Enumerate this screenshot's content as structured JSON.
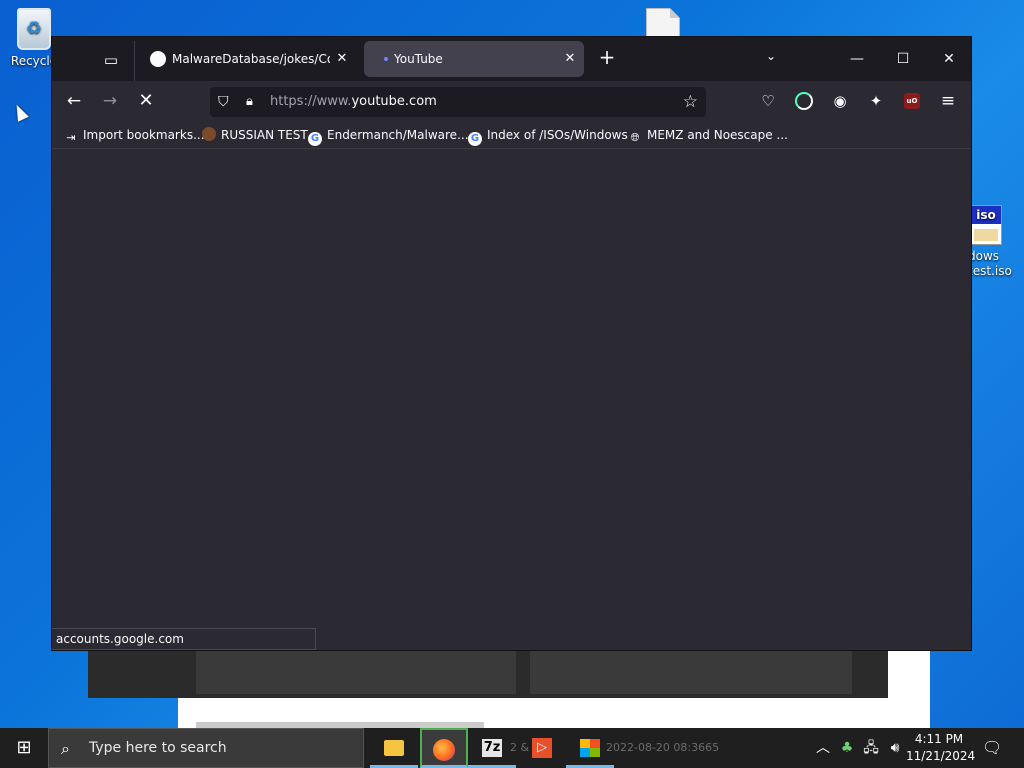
{
  "desktop": {
    "recycle_label": "Recycle",
    "iso_icon_title": "iso",
    "iso_label_line1": "dows",
    "iso_label_line2": "test.iso"
  },
  "browser": {
    "tabs": [
      {
        "title": "MalwareDatabase/jokes/Cookie",
        "icon": "github-icon",
        "active": false
      },
      {
        "title": "YouTube",
        "icon": "loading-dot-icon",
        "active": true
      }
    ],
    "url_prefix": "https://www.",
    "url_domain": "youtube.com",
    "bookmarks": [
      {
        "label": "Import bookmarks...",
        "icon": "import-icon"
      },
      {
        "label": "RUSSIAN TEST",
        "icon": "avatar-icon"
      },
      {
        "label": "Endermanch/Malware...",
        "icon": "google-icon"
      },
      {
        "label": "Index of /ISOs/Windows",
        "icon": "google-icon"
      },
      {
        "label": "MEMZ and Noescape ...",
        "icon": "globe-icon"
      }
    ],
    "status_text": "accounts.google.com"
  },
  "taskbar": {
    "search_placeholder": "Type here to search",
    "ghost_text": "2 &",
    "ghost_text2": "2022-08-20 08:3665",
    "time": "4:11 PM",
    "date": "11/21/2024"
  },
  "colors": {
    "desktop_blue": "#0b74da",
    "browser_bg": "#2b2a33",
    "tabbar_bg": "#1c1b22",
    "active_tab": "#42414d",
    "taskbar_bg": "#1f1f1f"
  }
}
